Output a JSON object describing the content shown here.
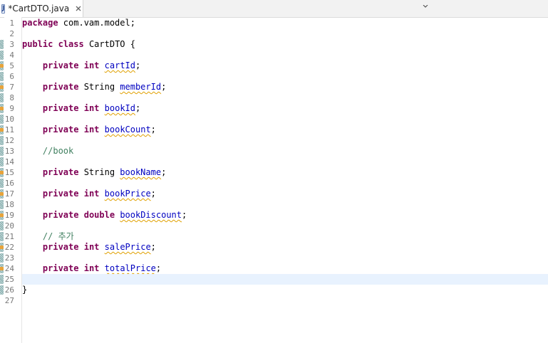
{
  "tab": {
    "title": "*CartDTO.java",
    "icon": "java-file-icon",
    "close_icon": "close-icon"
  },
  "colors": {
    "keyword": "#7f0055",
    "field": "#0000c0",
    "comment": "#3f7f5f",
    "current_line": "#e8f2fe",
    "warning": "#e8a33a"
  },
  "editor": {
    "current_line": 25,
    "lines": [
      {
        "n": "1",
        "tokens": [
          {
            "t": "kw",
            "v": "package"
          },
          {
            "t": "p",
            "v": " com.vam.model;"
          }
        ]
      },
      {
        "n": "2",
        "tokens": []
      },
      {
        "n": "3",
        "tokens": [
          {
            "t": "kw",
            "v": "public"
          },
          {
            "t": "p",
            "v": " "
          },
          {
            "t": "kw",
            "v": "class"
          },
          {
            "t": "p",
            "v": " CartDTO {"
          }
        ]
      },
      {
        "n": "4",
        "tokens": []
      },
      {
        "n": "5",
        "tokens": [
          {
            "t": "p",
            "v": "    "
          },
          {
            "t": "kw",
            "v": "private"
          },
          {
            "t": "p",
            "v": " "
          },
          {
            "t": "kw",
            "v": "int"
          },
          {
            "t": "p",
            "v": " "
          },
          {
            "t": "fld",
            "v": "cartId"
          },
          {
            "t": "p",
            "v": ";"
          }
        ]
      },
      {
        "n": "6",
        "tokens": []
      },
      {
        "n": "7",
        "tokens": [
          {
            "t": "p",
            "v": "    "
          },
          {
            "t": "kw",
            "v": "private"
          },
          {
            "t": "p",
            "v": " String "
          },
          {
            "t": "fld",
            "v": "memberId"
          },
          {
            "t": "p",
            "v": ";"
          }
        ]
      },
      {
        "n": "8",
        "tokens": []
      },
      {
        "n": "9",
        "tokens": [
          {
            "t": "p",
            "v": "    "
          },
          {
            "t": "kw",
            "v": "private"
          },
          {
            "t": "p",
            "v": " "
          },
          {
            "t": "kw",
            "v": "int"
          },
          {
            "t": "p",
            "v": " "
          },
          {
            "t": "fld",
            "v": "bookId"
          },
          {
            "t": "p",
            "v": ";"
          }
        ]
      },
      {
        "n": "10",
        "tokens": []
      },
      {
        "n": "11",
        "tokens": [
          {
            "t": "p",
            "v": "    "
          },
          {
            "t": "kw",
            "v": "private"
          },
          {
            "t": "p",
            "v": " "
          },
          {
            "t": "kw",
            "v": "int"
          },
          {
            "t": "p",
            "v": " "
          },
          {
            "t": "fld",
            "v": "bookCount"
          },
          {
            "t": "p",
            "v": ";"
          }
        ]
      },
      {
        "n": "12",
        "tokens": []
      },
      {
        "n": "13",
        "tokens": [
          {
            "t": "p",
            "v": "    "
          },
          {
            "t": "cmt",
            "v": "//book"
          }
        ]
      },
      {
        "n": "14",
        "tokens": []
      },
      {
        "n": "15",
        "tokens": [
          {
            "t": "p",
            "v": "    "
          },
          {
            "t": "kw",
            "v": "private"
          },
          {
            "t": "p",
            "v": " String "
          },
          {
            "t": "fld",
            "v": "bookName"
          },
          {
            "t": "p",
            "v": ";"
          }
        ]
      },
      {
        "n": "16",
        "tokens": []
      },
      {
        "n": "17",
        "tokens": [
          {
            "t": "p",
            "v": "    "
          },
          {
            "t": "kw",
            "v": "private"
          },
          {
            "t": "p",
            "v": " "
          },
          {
            "t": "kw",
            "v": "int"
          },
          {
            "t": "p",
            "v": " "
          },
          {
            "t": "fld",
            "v": "bookPrice"
          },
          {
            "t": "p",
            "v": ";"
          }
        ]
      },
      {
        "n": "18",
        "tokens": []
      },
      {
        "n": "19",
        "tokens": [
          {
            "t": "p",
            "v": "    "
          },
          {
            "t": "kw",
            "v": "private"
          },
          {
            "t": "p",
            "v": " "
          },
          {
            "t": "kw",
            "v": "double"
          },
          {
            "t": "p",
            "v": " "
          },
          {
            "t": "fld",
            "v": "bookDiscount"
          },
          {
            "t": "p",
            "v": ";"
          }
        ]
      },
      {
        "n": "20",
        "tokens": []
      },
      {
        "n": "21",
        "tokens": [
          {
            "t": "p",
            "v": "    "
          },
          {
            "t": "cmt",
            "v": "// 추가"
          }
        ]
      },
      {
        "n": "22",
        "tokens": [
          {
            "t": "p",
            "v": "    "
          },
          {
            "t": "kw",
            "v": "private"
          },
          {
            "t": "p",
            "v": " "
          },
          {
            "t": "kw",
            "v": "int"
          },
          {
            "t": "p",
            "v": " "
          },
          {
            "t": "fld",
            "v": "salePrice"
          },
          {
            "t": "p",
            "v": ";"
          }
        ]
      },
      {
        "n": "23",
        "tokens": []
      },
      {
        "n": "24",
        "tokens": [
          {
            "t": "p",
            "v": "    "
          },
          {
            "t": "kw",
            "v": "private"
          },
          {
            "t": "p",
            "v": " "
          },
          {
            "t": "kw",
            "v": "int"
          },
          {
            "t": "p",
            "v": " "
          },
          {
            "t": "fld",
            "v": "totalPrice"
          },
          {
            "t": "p",
            "v": ";"
          }
        ]
      },
      {
        "n": "25",
        "tokens": []
      },
      {
        "n": "26",
        "tokens": [
          {
            "t": "p",
            "v": "}"
          }
        ]
      },
      {
        "n": "27",
        "tokens": []
      }
    ]
  }
}
